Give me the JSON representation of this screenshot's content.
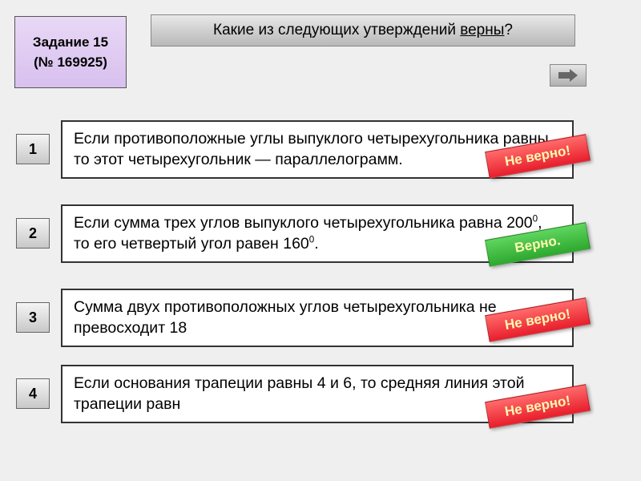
{
  "task": {
    "title": "Задание 15",
    "number": "(№ 169925)"
  },
  "question": {
    "prefix": "Какие из следующих утверждений ",
    "emph": "верны",
    "suffix": "?"
  },
  "nav": {
    "next": "next-arrow"
  },
  "statements": [
    {
      "num": "1",
      "html": "Если противоположные углы выпуклого четырехугольника равны, то этот четырехугольник — параллелограмм.",
      "badge": "Не верно!",
      "correct": false
    },
    {
      "num": "2",
      "html": "Если сумма трех углов выпуклого четырехугольника равна 200<sup>0</sup>, то его четвертый угол равен 160<sup>0</sup>.",
      "badge": "Верно.",
      "correct": true
    },
    {
      "num": "3",
      "html": "Сумма двух противоположных углов четырехугольника не превосходит 18",
      "badge": "Не верно!",
      "correct": false
    },
    {
      "num": "4",
      "html": "Если основания трапеции равны 4 и 6, то средняя линия этой трапеции равн",
      "badge": "Не верно!",
      "correct": false
    }
  ],
  "colors": {
    "accent_purple": "#d8c0ef",
    "badge_red": "#e81e2c",
    "badge_green": "#2ea82e"
  }
}
